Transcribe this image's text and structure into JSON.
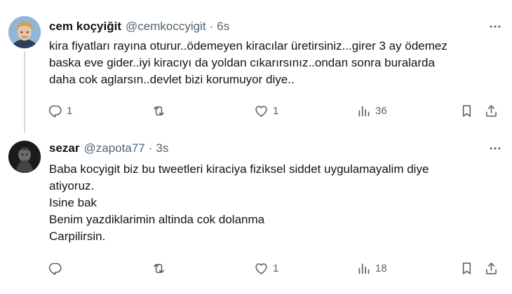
{
  "tweets": [
    {
      "name": "cem koçyiğit",
      "handle": "@cemkoccyigit",
      "separator": "·",
      "time": "6s",
      "lines": [
        "kira fiyatları rayına oturur..ödemeyen kiracılar üretirsiniz...girer 3 ay ödemez",
        "baska eve gider..iyi kiracıyı da yoldan cıkarırsınız..ondan sonra buralarda",
        "daha cok aglarsın..devlet bizi korumuyor diye.."
      ],
      "replies": "1",
      "retweets": "",
      "likes": "1",
      "views": "36"
    },
    {
      "name": "sezar",
      "handle": "@zapota77",
      "separator": "·",
      "time": "3s",
      "lines": [
        "Baba kocyigit biz bu tweetleri kiraciya fiziksel siddet uygulamayalim diye",
        "atiyoruz.",
        "Isine bak",
        "Benim yazdiklarimin altinda cok dolanma",
        "Carpilirsin."
      ],
      "replies": "",
      "retweets": "",
      "likes": "1",
      "views": "18"
    }
  ],
  "icons": {
    "reply": "reply-icon",
    "retweet": "retweet-icon",
    "like": "heart-icon",
    "views": "views-icon",
    "bookmark": "bookmark-icon",
    "share": "share-icon",
    "more": "more-icon"
  },
  "colors": {
    "text": "#0f1419",
    "secondary": "#536471",
    "thread_line": "#cfd9de"
  }
}
